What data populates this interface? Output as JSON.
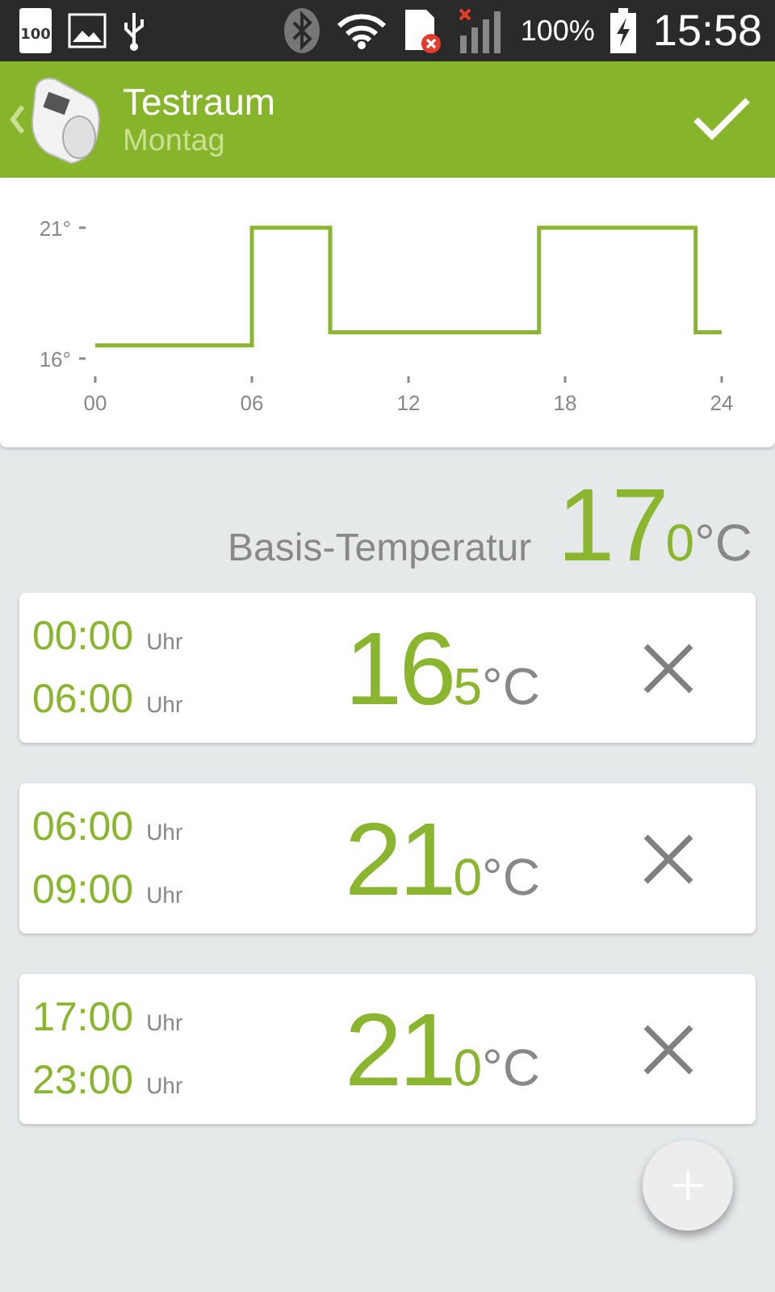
{
  "status_bar": {
    "battery_badge": "100",
    "battery_percent": "100%",
    "time": "15:58"
  },
  "header": {
    "title": "Testraum",
    "subtitle": "Montag"
  },
  "chart": {
    "chart_data": {
      "type": "line",
      "x": [
        0,
        6,
        6,
        9,
        9,
        17,
        17,
        23,
        23,
        24
      ],
      "series": [
        {
          "color": "#8ab52e",
          "values": [
            16.5,
            16.5,
            21,
            21,
            17,
            17,
            21,
            21,
            17,
            17
          ]
        }
      ],
      "xlim": [
        0,
        24
      ],
      "ylim": [
        16,
        21
      ],
      "xticks": [
        {
          "value": 0,
          "label": "00"
        },
        {
          "value": 6,
          "label": "06"
        },
        {
          "value": 12,
          "label": "12"
        },
        {
          "value": 18,
          "label": "18"
        },
        {
          "value": 24,
          "label": "24"
        }
      ],
      "yticks": [
        {
          "value": 16,
          "label": "16°"
        },
        {
          "value": 21,
          "label": "21°"
        }
      ]
    }
  },
  "base_temperature": {
    "label": "Basis-Temperatur",
    "whole": "17",
    "decimal": "0",
    "unit": "°C"
  },
  "periods": [
    {
      "start": "00:00",
      "start_unit": "Uhr",
      "end": "06:00",
      "end_unit": "Uhr",
      "whole": "16",
      "decimal": "5",
      "unit": "°C"
    },
    {
      "start": "06:00",
      "start_unit": "Uhr",
      "end": "09:00",
      "end_unit": "Uhr",
      "whole": "21",
      "decimal": "0",
      "unit": "°C"
    },
    {
      "start": "17:00",
      "start_unit": "Uhr",
      "end": "23:00",
      "end_unit": "Uhr",
      "whole": "21",
      "decimal": "0",
      "unit": "°C"
    }
  ]
}
